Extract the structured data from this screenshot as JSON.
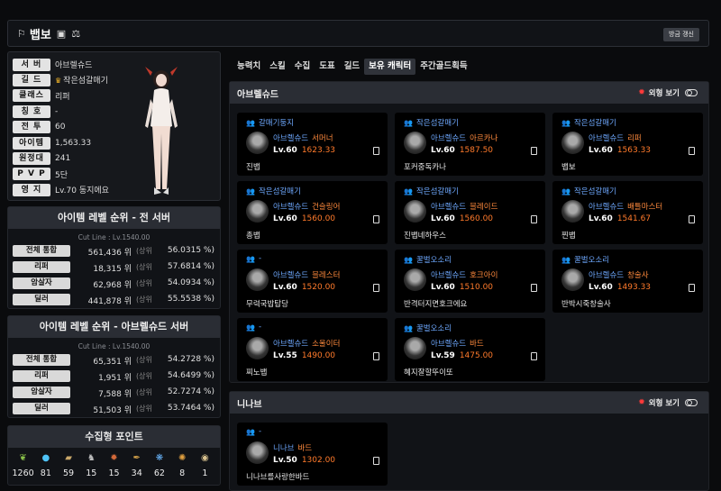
{
  "header": {
    "title": "뱁보",
    "refresh_label": "방금 갱신"
  },
  "profile": {
    "rows": [
      {
        "label": "서 버",
        "value": "아브렐슈드"
      },
      {
        "label": "길 드",
        "value": "작은섬갈매기",
        "crown": true
      },
      {
        "label": "클래스",
        "value": "리퍼"
      },
      {
        "label": "칭 호",
        "value": "-"
      },
      {
        "label": "전 투",
        "value": "60"
      },
      {
        "label": "아이템",
        "value": "1,563.33"
      },
      {
        "label": "원정대",
        "value": "241"
      },
      {
        "label": "P V P",
        "value": "5단"
      },
      {
        "label": "영 지",
        "value": "Lv.70 동지에요"
      }
    ]
  },
  "ranking_all": {
    "title": "아이템 레벨 순위 - 전 서버",
    "cutline": "Cut Line : Lv.1540.00",
    "rows": [
      {
        "label": "전체 통합",
        "value": "561,436 위",
        "unit": "(상위",
        "pct": "56.0315 %)"
      },
      {
        "label": "리퍼",
        "value": "18,315 위",
        "unit": "(상위",
        "pct": "57.6814 %)"
      },
      {
        "label": "암살자",
        "value": "62,968 위",
        "unit": "(상위",
        "pct": "54.0934 %)"
      },
      {
        "label": "딜러",
        "value": "441,878 위",
        "unit": "(상위",
        "pct": "55.5538 %)"
      }
    ]
  },
  "ranking_server": {
    "title": "아이템 레벨 순위 - 아브렐슈드 서버",
    "cutline": "Cut Line : Lv.1540.00",
    "rows": [
      {
        "label": "전체 통합",
        "value": "65,351 위",
        "unit": "(상위",
        "pct": "54.2728 %)"
      },
      {
        "label": "리퍼",
        "value": "1,951 위",
        "unit": "(상위",
        "pct": "54.6499 %)"
      },
      {
        "label": "암살자",
        "value": "7,588 위",
        "unit": "(상위",
        "pct": "52.7274 %)"
      },
      {
        "label": "딜러",
        "value": "51,503 위",
        "unit": "(상위",
        "pct": "53.7464 %)"
      }
    ]
  },
  "collection": {
    "title": "수집형 포인트",
    "items": [
      {
        "icon": "seed-icon",
        "glyph": "❦",
        "color": "#8bc34a",
        "count": "1260"
      },
      {
        "icon": "island-heart-icon",
        "glyph": "●",
        "color": "#4fc3f7",
        "count": "81"
      },
      {
        "icon": "art-icon",
        "glyph": "▰",
        "color": "#c9a86a",
        "count": "59"
      },
      {
        "icon": "statue-icon",
        "glyph": "♞",
        "color": "#bbbbbb",
        "count": "15"
      },
      {
        "icon": "mask-icon",
        "glyph": "✹",
        "color": "#d2693a",
        "count": "15"
      },
      {
        "icon": "adventure-icon",
        "glyph": "✒",
        "color": "#d4a24a",
        "count": "34"
      },
      {
        "icon": "leaf-icon",
        "glyph": "❋",
        "color": "#6ab7ff",
        "count": "62"
      },
      {
        "icon": "star-icon",
        "glyph": "✺",
        "color": "#e0a040",
        "count": "8"
      },
      {
        "icon": "orb-icon",
        "glyph": "◉",
        "color": "#d9c28f",
        "count": "1"
      }
    ]
  },
  "tabs": [
    "능력치",
    "스킬",
    "수집",
    "도표",
    "길드",
    "보유 캐릭터",
    "주간골드획득"
  ],
  "active_tab": 5,
  "servers": [
    {
      "name": "아브렐슈드",
      "toggle_label": "외형 보기",
      "cards": [
        {
          "guild": "갈매기둥지",
          "server": "아브렐슈드",
          "class": "서머너",
          "level": "Lv.60",
          "ilvl": "1623.33",
          "nick": "진뱁"
        },
        {
          "guild": "작은섬갈매기",
          "server": "아브렐슈드",
          "class": "아르카나",
          "level": "Lv.60",
          "ilvl": "1587.50",
          "nick": "포커중독카나"
        },
        {
          "guild": "작은섬갈매기",
          "server": "아브렐슈드",
          "class": "리퍼",
          "level": "Lv.60",
          "ilvl": "1563.33",
          "nick": "뱁보"
        },
        {
          "guild": "작은섬갈매기",
          "server": "아브렐슈드",
          "class": "건슬링어",
          "level": "Lv.60",
          "ilvl": "1560.00",
          "nick": "총뱁"
        },
        {
          "guild": "작은섬갈매기",
          "server": "아브렐슈드",
          "class": "블레이드",
          "level": "Lv.60",
          "ilvl": "1560.00",
          "nick": "진뱁네하우스"
        },
        {
          "guild": "작은섬갈매기",
          "server": "아브렐슈드",
          "class": "배틀마스터",
          "level": "Lv.60",
          "ilvl": "1541.67",
          "nick": "찐뱁"
        },
        {
          "guild": "-",
          "server": "아브렐슈드",
          "class": "블레스터",
          "level": "Lv.60",
          "ilvl": "1520.00",
          "nick": "무력국밥탑당"
        },
        {
          "guild": "꿀벌오소리",
          "server": "아브렐슈드",
          "class": "호크아이",
          "level": "Lv.60",
          "ilvl": "1510.00",
          "nick": "반격터지면호크에요"
        },
        {
          "guild": "꿀벌오소리",
          "server": "아브렐슈드",
          "class": "창술사",
          "level": "Lv.60",
          "ilvl": "1493.33",
          "nick": "반박시죽창술사"
        },
        {
          "guild": "-",
          "server": "아브렐슈드",
          "class": "소울이터",
          "level": "Lv.55",
          "ilvl": "1490.00",
          "nick": "찌노뱁"
        },
        {
          "guild": "꿀벌오소리",
          "server": "아브렐슈드",
          "class": "바드",
          "level": "Lv.59",
          "ilvl": "1475.00",
          "nick": "혜지잘할뚜이또"
        }
      ]
    },
    {
      "name": "니나브",
      "toggle_label": "외형 보기",
      "cards": [
        {
          "guild": "-",
          "server": "니나브",
          "class": "바드",
          "level": "Lv.50",
          "ilvl": "1302.00",
          "nick": "니나브를사랑한바드"
        }
      ]
    }
  ]
}
